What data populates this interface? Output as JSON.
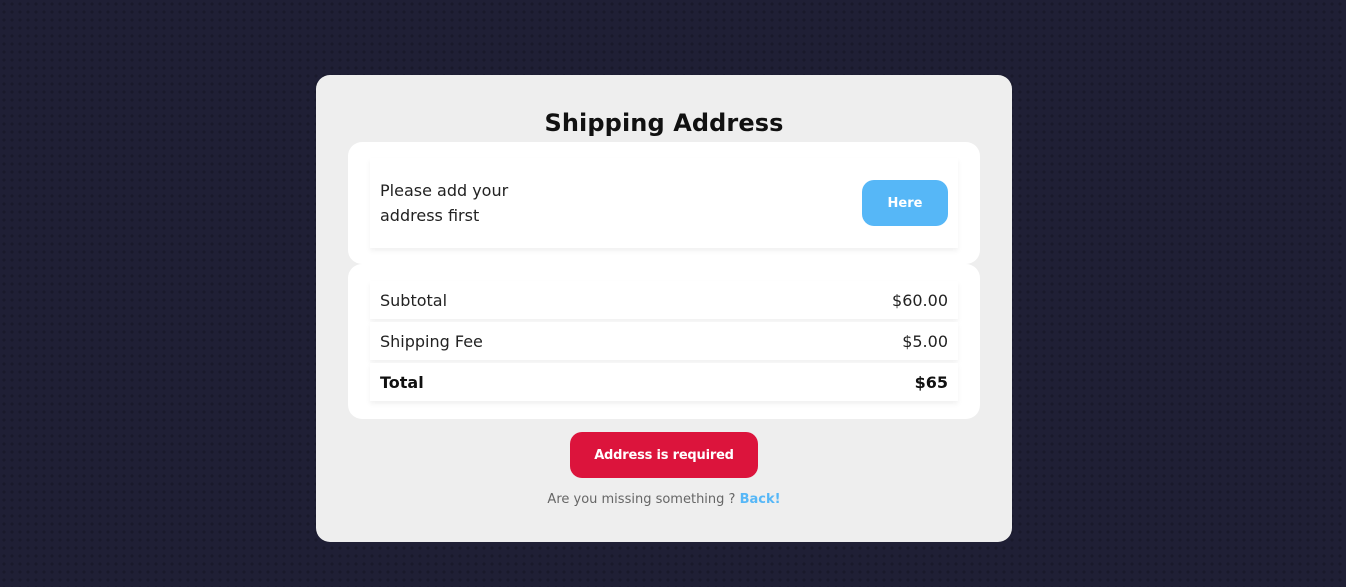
{
  "page": {
    "title": "Shipping Address"
  },
  "address": {
    "message": "Please add your address first",
    "button_label": "Here"
  },
  "summary": {
    "rows": [
      {
        "label": "Subtotal",
        "value": "$60.00"
      },
      {
        "label": "Shipping Fee",
        "value": "$5.00"
      },
      {
        "label": "Total",
        "value": "$65"
      }
    ]
  },
  "actions": {
    "alert_label": "Address is required"
  },
  "footer": {
    "prompt": "Are you missing something ?",
    "back_label": "Back!"
  },
  "colors": {
    "background": "#1f1f35",
    "card": "#eeeeee",
    "accent_blue": "#56b7f7",
    "alert_red": "#dc143c"
  }
}
